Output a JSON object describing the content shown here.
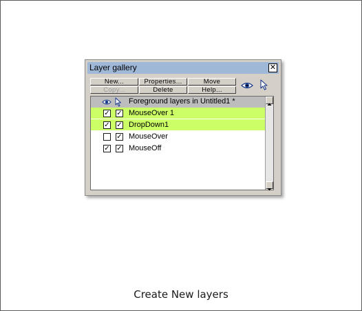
{
  "panel": {
    "title": "Layer gallery",
    "close_glyph": "✕",
    "buttons": {
      "new": "New...",
      "properties": "Properties...",
      "move": "Move",
      "copy": "Copy...",
      "delete": "Delete",
      "help": "Help..."
    },
    "icons": [
      "eye-icon",
      "pointer-icon"
    ],
    "header": "Foreground layers in Untitled1 *",
    "layers": [
      {
        "name": "MouseOver 1",
        "visible": true,
        "editable": true,
        "highlighted": true
      },
      {
        "name": "DropDown1",
        "visible": true,
        "editable": true,
        "highlighted": true
      },
      {
        "name": "MouseOver",
        "visible": false,
        "editable": true,
        "highlighted": false
      },
      {
        "name": "MouseOff",
        "visible": true,
        "editable": true,
        "highlighted": false
      }
    ],
    "check_glyph": "✓"
  },
  "caption": "Create New layers",
  "colors": {
    "titlebar": "#9fb8d8",
    "highlight": "#ccff66",
    "panel": "#d4d0c8"
  }
}
